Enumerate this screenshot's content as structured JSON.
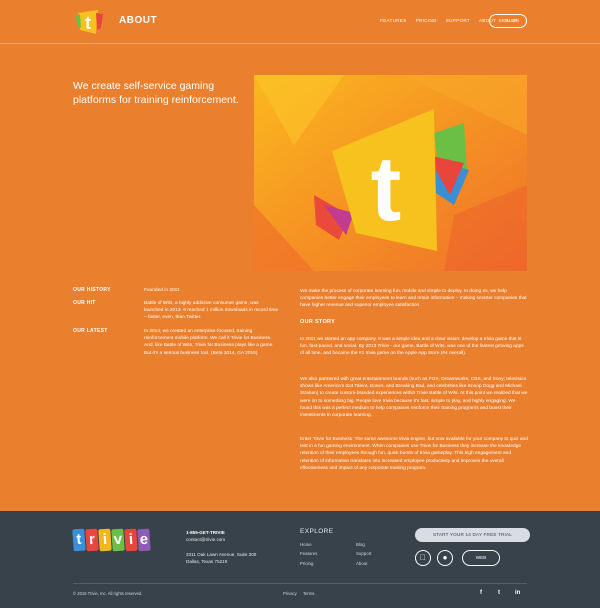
{
  "header": {
    "title": "ABOUT",
    "nav": [
      "FEATURES",
      "PRICING",
      "SUPPORT",
      "ABOUT",
      "BLOG"
    ],
    "signup": "SIGN UP",
    "logo_letter": "t"
  },
  "hero": {
    "headline": "We create self-service gaming platforms for training reinforcement.",
    "image_letter": "t"
  },
  "facts": [
    {
      "label": "OUR HISTORY",
      "text": "Founded in 2011"
    },
    {
      "label": "OUR HIT",
      "text": "Battle of Wits, a highly addictive consumer game, was launched in 2013. It reached 1 million downloads in record time – faster, even, than Twitter."
    },
    {
      "label": "OUR LATEST",
      "text": "In 2014, we created an enterprise-focused, training reinforcement mobile platform. We call it Trivie for Business. And, like Battle of Wits, Trivie for Business plays like a game. But it's a serious business tool. (Beta 2014, GA 2015)"
    }
  ],
  "intro": "We make the process of corporate learning fun, mobile and simple to deploy. In doing so, we help companies better engage their employees to learn and retain information – making smarter companies that have higher revenue and superior employee satisfaction.",
  "story": {
    "title": "OUR STORY",
    "paragraphs": [
      "In 2011 we started an app company. It was a simple idea and a clear vision: develop a trivia game that is fun, fast-paced, and social. By 2013 Trivie - our game, Battle of Wits, was one of the fastest growing apps of all time, and became the #1 trivia game on the Apple App Store (#4 overall).",
      "We also partnered with great entertainment brands (such as FOX, Dreamworks, CBS, and Sony; television shows like America's Got Talent, Bones, and Breaking Bad, and celebrities like Snoop Dogg and Michael Strahan) to create custom-branded experiences within Trivie Battle of Wits. At this point we realized that we were on to something big. People love trivia because it's fast, simple to play, and highly engaging. We found this was a perfect medium to help companies reinforce their training programs and boost their investments in corporate learning.",
      "Enter Trivie for Business. The same awesome trivia engine, but now available for your company to quiz and test in a fun gaming environment. When companies use Trivie for Business they increase the knowledge retention of their employees through fun, quick bursts of trivia gameplay. This high engagement and retention of information translates into increased employee productivity and improves the overall effectiveness and impact of any corporate training program."
    ]
  },
  "footer": {
    "logo_letters": [
      "t",
      "r",
      "i",
      "v",
      "i",
      "e"
    ],
    "logo_colors": [
      "#3a8fd6",
      "#e8463c",
      "#f2b71e",
      "#6cbf45",
      "#e8463c",
      "#8e5bb5"
    ],
    "phone": "1-855-GET-TRIVIE",
    "email": "contact@trivie.com",
    "address1": "2311 Oak Lawn Avenue, Suite 300",
    "address2": "Dallas, Texas 75219",
    "explore_title": "EXPLORE",
    "explore_col1": [
      "Home",
      "Features",
      "Pricing"
    ],
    "explore_col2": [
      "Blog",
      "Support",
      "About"
    ],
    "trial_button": "START YOUR 14 DAY FREE TRIAL",
    "apple_icon": "apple-icon",
    "android_icon": "android-icon",
    "web_button": "WEB",
    "copyright": "© 2015 Trivie, Inc. All rights reserved.",
    "privacy": "Privacy",
    "terms": "Terms",
    "social": [
      "f",
      "t",
      "in"
    ]
  },
  "colors": {
    "background": "#ea7f2e",
    "footer": "#37424b",
    "logo_yellow": "#f7c21d"
  }
}
